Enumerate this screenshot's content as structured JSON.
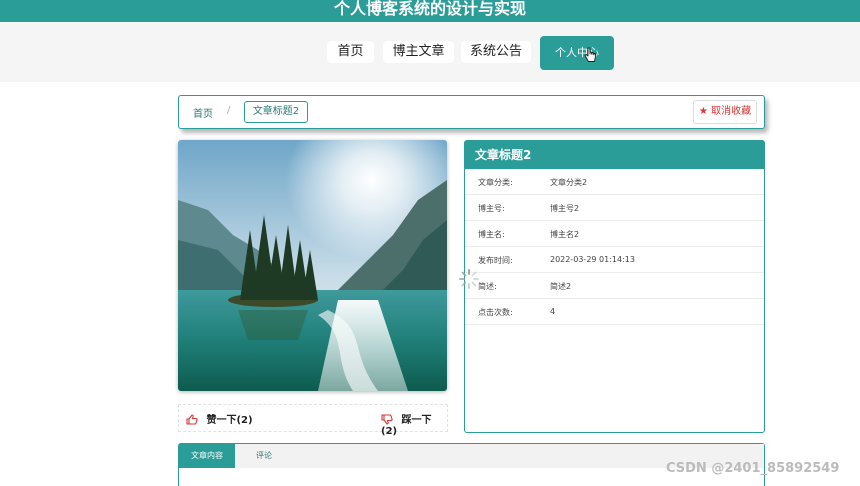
{
  "header": {
    "title": "个人博客系统的设计与实现"
  },
  "nav": {
    "items": [
      {
        "label": "首页"
      },
      {
        "label": "博主文章"
      },
      {
        "label": "系统公告"
      },
      {
        "label": "个人中心"
      }
    ]
  },
  "breadcrumb": {
    "home": "首页",
    "separator": "/",
    "current": "文章标题2"
  },
  "actions": {
    "unfavorite_icon": "★",
    "unfavorite": "取消收藏"
  },
  "votes": {
    "like": "赞一下(2)",
    "dislike": "踩一下(2)"
  },
  "article": {
    "title": "文章标题2",
    "rows": [
      {
        "label": "文章分类:",
        "value": "文章分类2"
      },
      {
        "label": "博主号:",
        "value": "博主号2"
      },
      {
        "label": "博主名:",
        "value": "博主名2"
      },
      {
        "label": "发布时间:",
        "value": "2022-03-29 01:14:13"
      },
      {
        "label": "简述:",
        "value": "简述2"
      },
      {
        "label": "点击次数:",
        "value": "4"
      }
    ]
  },
  "tabs": {
    "items": [
      {
        "label": "文章内容"
      },
      {
        "label": "评论"
      }
    ]
  },
  "watermark": "CSDN @2401_85892549",
  "colors": {
    "accent": "#2a9d98",
    "danger": "#d33333"
  }
}
